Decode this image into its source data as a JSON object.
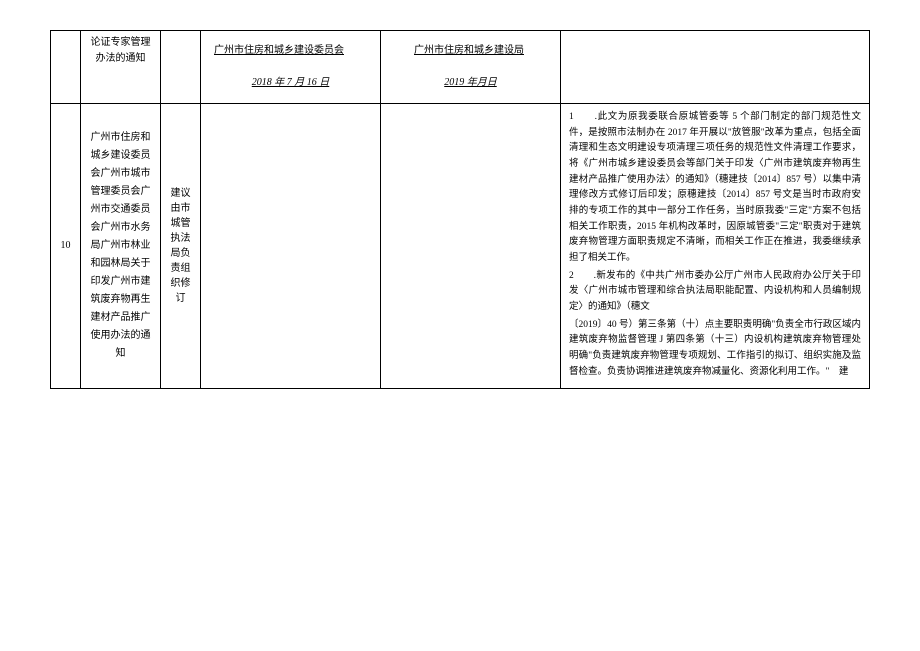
{
  "row1": {
    "title": "论证专家管理办法的通知",
    "org1": {
      "name": "广州市住房和城乡建设委员会",
      "date": "2018 年 7 月 16 日"
    },
    "org2": {
      "name": "广州市住房和城乡建设局",
      "date": "2019 年月日"
    }
  },
  "row2": {
    "num": "10",
    "title": "广州市住房和城乡建设委员会广州市城市管理委员会广州市交通委员会广州市水务局广州市林业和园林局关于印发广州市建筑废弃物再生建材产品推广使用办法的通知",
    "suggest": "建议由市城管执法局负责组织修订",
    "remark_p1": "1　　.此文为原我委联合原城管委等 5 个部门制定的部门规范性文件，是按照市法制办在 2017 年开展以\"放管服\"改革为重点，包括全面清理和生态文明建设专项清理三项任务的规范性文件清理工作要求，将《广州市城乡建设委员会等部门关于印发〈广州市建筑废弃物再生建材产品推广使用办法〉的通知》（穗建技〔2014〕857 号）以集中清理修改方式修订后印发；原穗建技〔2014〕857 号文是当时市政府安排的专项工作的其中一部分工作任务，当时原我委\"三定\"方案不包括相关工作职责，2015 年机构改革时，因原城管委\"三定\"职责对于建筑废弃物管理方面职责规定不清晰，而相关工作正在推进，我委继续承担了相关工作。",
    "remark_p2": "2　　.新发布的《中共广州市委办公厅广州市人民政府办公厅关于印发〈广州市城市管理和综合执法局职能配置、内设机构和人员编制规定〉的通知》（穗文",
    "remark_p3": "〔2019〕40 号）第三条第（十）点主要职责明确\"负责全市行政区域内建筑废弃物监督管理 J 第四条第（十三）内设机构建筑废弃物管理处明确\"负责建筑废弃物管理专项规划、工作指引的拟订、组织实施及监督检查。负责协调推进建筑废弃物减量化、资源化利用工作。\"　建"
  }
}
